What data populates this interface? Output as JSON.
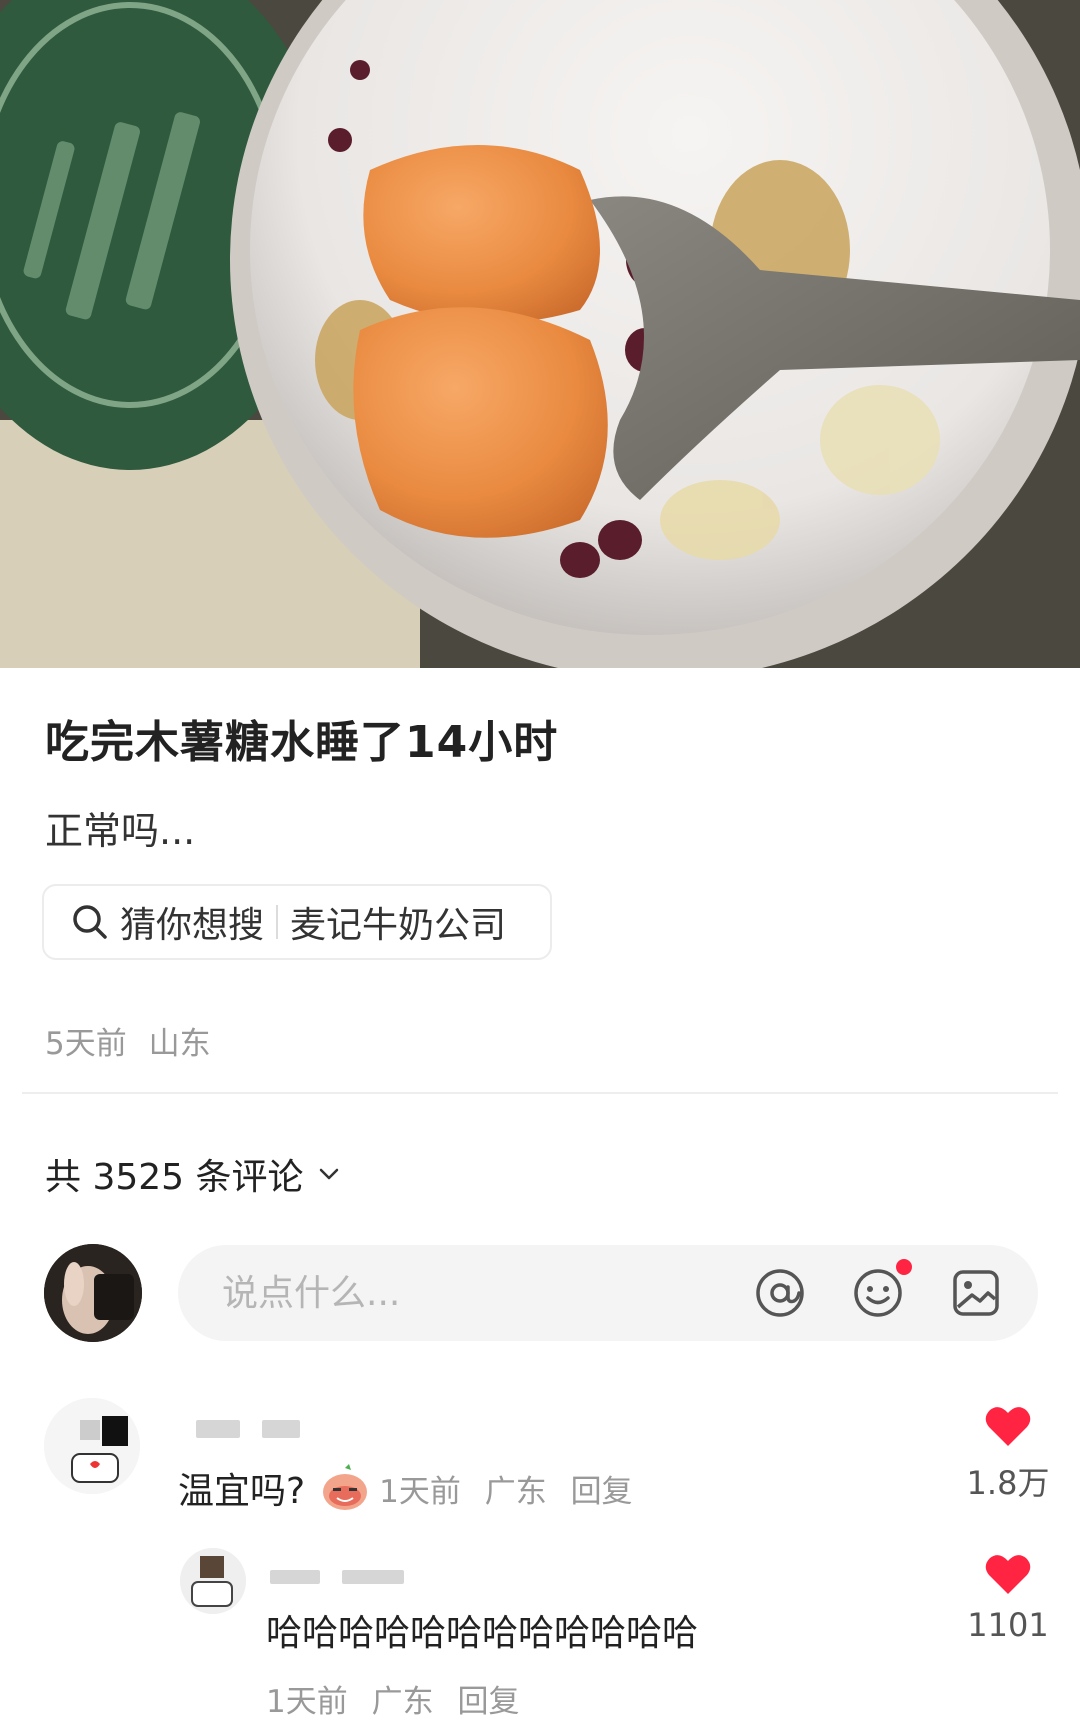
{
  "post": {
    "title": "吃完木薯糖水睡了14小时",
    "body": "正常吗...",
    "search_chip": {
      "lead": "猜你想搜",
      "term": "麦记牛奶公司",
      "icon": "search-icon"
    },
    "meta": {
      "time": "5天前",
      "location": "山东"
    }
  },
  "comments_header": {
    "count_label": "共 3525 条评论",
    "icon": "chevron-down-icon"
  },
  "comment_input": {
    "placeholder": "说点什么...",
    "tools": [
      "at-icon",
      "emoji-icon",
      "image-icon"
    ],
    "notification_color": "#ff2442"
  },
  "comments": [
    {
      "text": "温宜吗?",
      "emoji": "peach-face-emoji",
      "time": "1天前",
      "location": "广东",
      "reply_label": "回复",
      "likes": "1.8万"
    }
  ],
  "replies": [
    {
      "text": "哈哈哈哈哈哈哈哈哈哈哈哈",
      "time": "1天前",
      "location": "广东",
      "reply_label": "回复",
      "likes": "1101"
    }
  ],
  "colors": {
    "like": "#ff2442",
    "muted_text": "#999999",
    "input_bg": "#f4f4f4"
  }
}
